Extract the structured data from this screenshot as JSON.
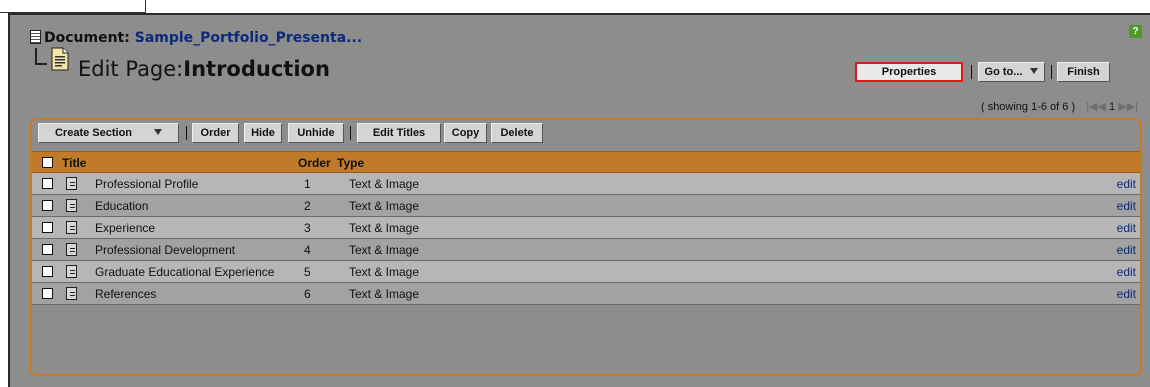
{
  "header": {
    "document_prefix": "Document:",
    "document_name": "Sample_Portfolio_Presenta...",
    "edit_page_prefix": "Edit Page:",
    "page_name": "Introduction",
    "help_icon": "?"
  },
  "actions": {
    "properties_label": "Properties",
    "goto_label": "Go to...",
    "finish_label": "Finish"
  },
  "pagination": {
    "showing_text": "( showing 1-6 of 6 )",
    "current_page": "1",
    "first_glyph": "|◀◀",
    "next_glyph": "▶▶|"
  },
  "toolbar": {
    "create_section_label": "Create Section",
    "order_label": "Order",
    "hide_label": "Hide",
    "unhide_label": "Unhide",
    "edit_titles_label": "Edit Titles",
    "copy_label": "Copy",
    "delete_label": "Delete"
  },
  "table": {
    "columns": [
      "Title",
      "Order",
      "Type"
    ],
    "rows": [
      {
        "title": "Professional Profile",
        "order": "1",
        "type": "Text & Image",
        "action": "edit"
      },
      {
        "title": "Education",
        "order": "2",
        "type": "Text & Image",
        "action": "edit"
      },
      {
        "title": "Experience",
        "order": "3",
        "type": "Text & Image",
        "action": "edit"
      },
      {
        "title": "Professional Development",
        "order": "4",
        "type": "Text & Image",
        "action": "edit"
      },
      {
        "title": "Graduate Educational Experience",
        "order": "5",
        "type": "Text & Image",
        "action": "edit"
      },
      {
        "title": "References",
        "order": "6",
        "type": "Text & Image",
        "action": "edit"
      }
    ]
  },
  "colors": {
    "panel_bg": "#8d8d8d",
    "accent_orange": "#c07a2a",
    "link_blue": "#0b2a7a",
    "highlight_red": "#e01a1a"
  }
}
